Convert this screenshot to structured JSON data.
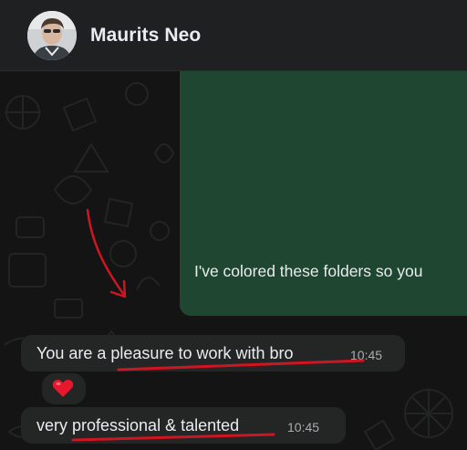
{
  "header": {
    "contact_name": "Maurits Neo",
    "avatar_icon": "profile-photo"
  },
  "messages": [
    {
      "type": "media",
      "caption": "I've colored these folders so you",
      "bubble_color": "#1e4630"
    },
    {
      "type": "text",
      "text": "You are a pleasure to work with bro",
      "time": "10:45",
      "reaction": "heart-emoji"
    },
    {
      "type": "text",
      "text": "very professional & talented",
      "time": "10:45"
    }
  ],
  "annotations": {
    "color": "#d01522",
    "items": [
      "arrow-annotation",
      "underline-pleasure",
      "underline-professional"
    ]
  }
}
